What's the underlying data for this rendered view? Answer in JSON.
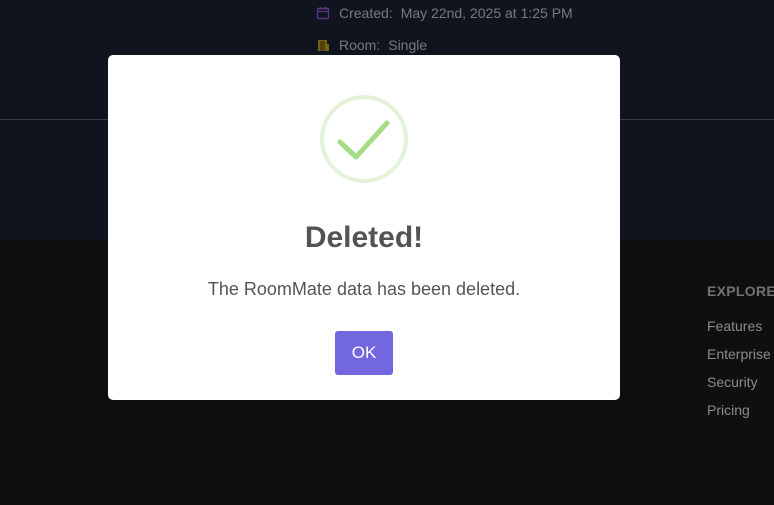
{
  "details": {
    "created_label": "Created:",
    "created_value": "May 22nd, 2025 at 1:25 PM",
    "room_label": "Room:",
    "room_value": "Single"
  },
  "footer": {
    "explore_heading": "EXPLORE",
    "links": [
      "Features",
      "Enterprise",
      "Security",
      "Pricing"
    ]
  },
  "dialog": {
    "icon": "success-check-icon",
    "title": "Deleted!",
    "message": "The RoomMate data has been deleted.",
    "ok_label": "OK"
  },
  "colors": {
    "top_background": "#1b2233",
    "footer_background": "#1a1a1a",
    "accent_button": "#7367e0",
    "success_green": "#a5dc86",
    "calendar_icon": "#8f5bd6",
    "room_icon": "#c9a227"
  }
}
